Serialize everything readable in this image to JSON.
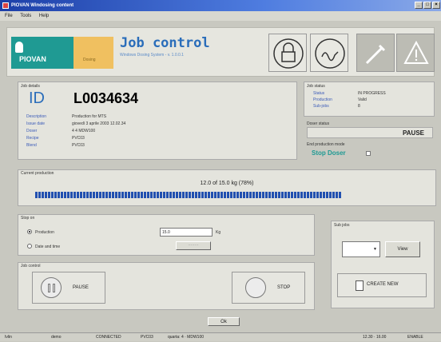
{
  "window": {
    "title": "PIOVAN Windosing content"
  },
  "menu": [
    "File",
    "Tools",
    "Help"
  ],
  "header": {
    "brand": "PIOVAN",
    "brand2": "Dosing",
    "title": "Job control",
    "subtitle": "Windows Dosing System - v. 1.0.0.1"
  },
  "job_details": {
    "group_label": "Job details",
    "id_label": "ID",
    "id_value": "L0034634",
    "fields": [
      {
        "label": "Description",
        "value": "Production for MTS"
      },
      {
        "label": "Issue date",
        "value": "giovedì 3 aprile 2003 12.02.34"
      },
      {
        "label": "Doser",
        "value": "4    4 MDW100"
      },
      {
        "label": "Recipe",
        "value": "PVC03"
      },
      {
        "label": "Blend",
        "value": "PVC03"
      }
    ]
  },
  "job_status": {
    "group_label": "Job status",
    "fields": [
      {
        "label": "Status",
        "value": "IN PROGRESS"
      },
      {
        "label": "Production",
        "value": "Valid"
      },
      {
        "label": "Sub-jobs",
        "value": "8"
      }
    ]
  },
  "doser_status": {
    "group_label": "Doser status",
    "value": "PAUSE"
  },
  "end_mode": {
    "group_label": "End production mode",
    "value": "Stop Doser"
  },
  "production": {
    "group_label": "Current production",
    "text": "12.0 of 15.0 kg (78%)",
    "progress": 0.78
  },
  "stop_on": {
    "group_label": "Stop on",
    "option_production": "Production",
    "option_date": "Date and time",
    "production_value": "15.0",
    "unit": "Kg",
    "date_button": "........"
  },
  "sub_jobs": {
    "group_label": "Sub jobs",
    "view_button": "View",
    "create_button": "CREATE NEW"
  },
  "job_control": {
    "group_label": "Job control",
    "pause_button": "PAUSE",
    "stop_button": "STOP"
  },
  "ok_button": "Ok",
  "statusbar": {
    "user": "Ivlin",
    "level": "demo",
    "connection": "CONNECTED",
    "recipe": "PVC03",
    "doser": "quarta: 4 · MDW100",
    "time": "12.30 · 16.00",
    "caps": "ENABLE"
  },
  "colors": {
    "accent": "#2a6dba",
    "progress": "#2250b0",
    "brand": "#1f9a93"
  }
}
